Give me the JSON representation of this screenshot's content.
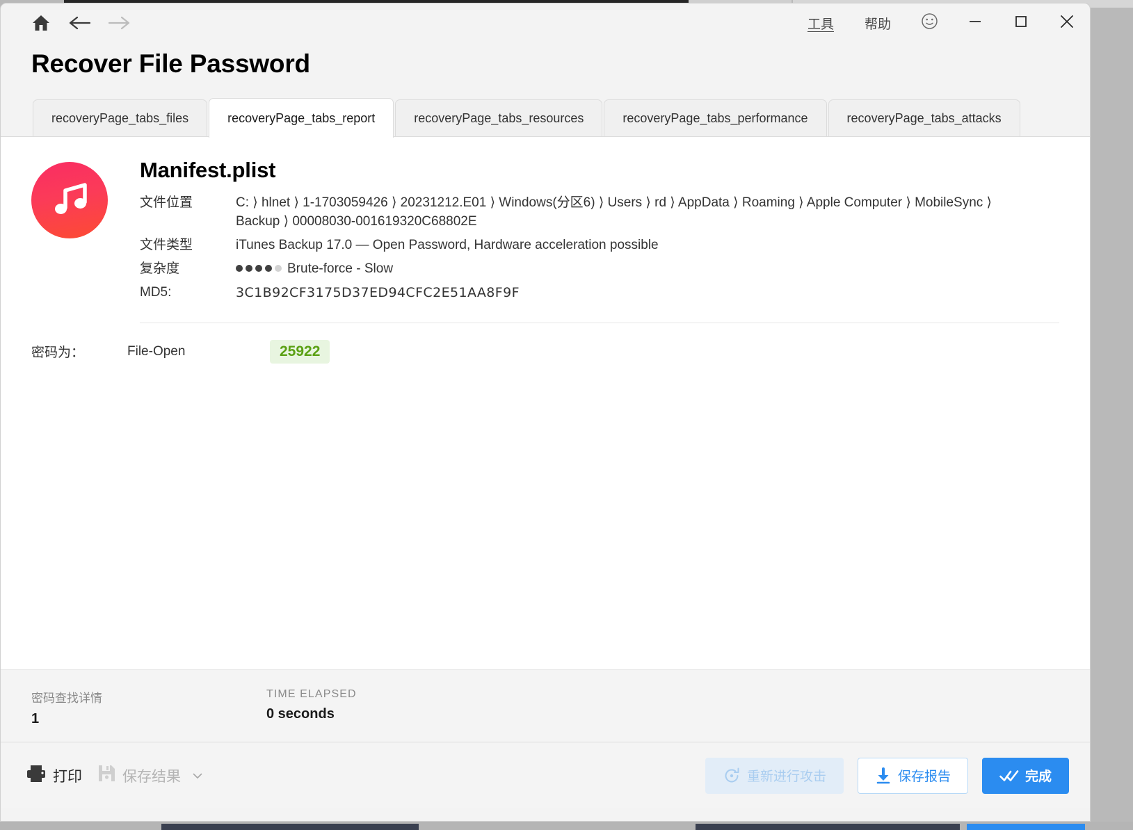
{
  "window": {
    "title": "Recover File Password",
    "titlebar": {
      "home_icon": "home-icon",
      "back_icon": "arrow-left-icon",
      "forward_icon": "arrow-right-icon",
      "tools_label": "工具",
      "help_label": "帮助",
      "feedback_icon": "smiley-face-icon",
      "minimize_icon": "minimize-icon",
      "maximize_icon": "maximize-icon",
      "close_icon": "close-icon"
    }
  },
  "tabs": [
    {
      "label": "recoveryPage_tabs_files",
      "active": false
    },
    {
      "label": "recoveryPage_tabs_report",
      "active": true
    },
    {
      "label": "recoveryPage_tabs_resources",
      "active": false
    },
    {
      "label": "recoveryPage_tabs_performance",
      "active": false
    },
    {
      "label": "recoveryPage_tabs_attacks",
      "active": false
    }
  ],
  "report": {
    "file_icon": "itunes-music-icon",
    "file_name": "Manifest.plist",
    "rows": [
      {
        "label": "文件位置",
        "value": "C: ⟩ hlnet ⟩ 1-1703059426 ⟩ 20231212.E01 ⟩ Windows(分区6) ⟩ Users ⟩ rd ⟩ AppData ⟩ Roaming ⟩ Apple Computer ⟩ MobileSync ⟩ Backup ⟩ 00008030-001619320C68802E"
      },
      {
        "label": "文件类型",
        "value": "iTunes Backup 17.0 — Open Password, Hardware acceleration possible"
      },
      {
        "label": "复杂度",
        "value": "Brute-force - Slow",
        "dots_filled": 4,
        "dots_total": 5
      },
      {
        "label": "MD5:",
        "value": "3C1B92CF3175D37ED94CFC2E51AA8F9F"
      }
    ],
    "password": {
      "label": "密码为：",
      "kind": "File-Open",
      "value": "25922",
      "badge_bg": "#e8f5e0",
      "badge_fg": "#5aa013"
    }
  },
  "status": {
    "detail_caption": "密码查找详情",
    "detail_value": "1",
    "elapsed_caption": "TIME ELAPSED",
    "elapsed_value": "0 seconds"
  },
  "actions": {
    "print": {
      "label": "打印",
      "icon": "printer-icon"
    },
    "save_results": {
      "label": "保存结果",
      "icon": "floppy-disk-icon",
      "dropdown_icon": "chevron-down-icon"
    },
    "rerun_attack": {
      "label": "重新进行攻击",
      "icon": "refresh-icon"
    },
    "save_report": {
      "label": "保存报告",
      "icon": "download-icon"
    },
    "finish": {
      "label": "完成",
      "icon": "double-check-icon"
    }
  },
  "colors": {
    "accent": "#2b8cf0",
    "accent_light": "#e2edf8",
    "success": "#5aa013"
  }
}
